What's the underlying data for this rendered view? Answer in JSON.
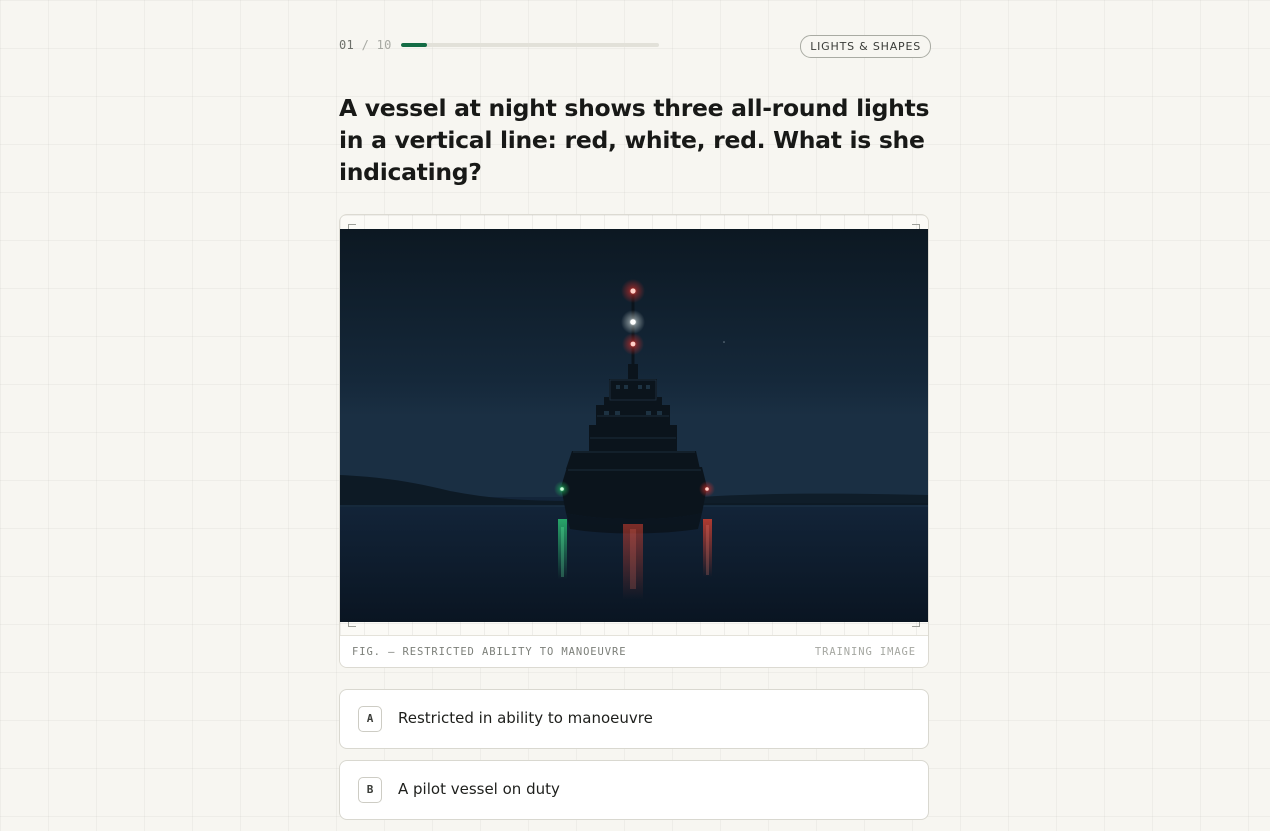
{
  "progress": {
    "current": "01",
    "separator": "/",
    "total": "10",
    "fraction": 0.1,
    "accent_color": "#146c45"
  },
  "category": "LIGHTS & SHAPES",
  "question": "A vessel at night shows three all-round lights in a vertical line: red, white, red. What is she indicating?",
  "figure": {
    "caption": "FIG. — RESTRICTED ABILITY TO MANOEUVRE",
    "tag": "TRAINING IMAGE",
    "image_alt": "Dark silhouette of a vessel on calm water at night showing red-white-red all-round lights on her mast, with a green and a red sidelight"
  },
  "answers": [
    {
      "key": "A",
      "text": "Restricted in ability to manoeuvre"
    },
    {
      "key": "B",
      "text": "A pilot vessel on duty"
    }
  ]
}
